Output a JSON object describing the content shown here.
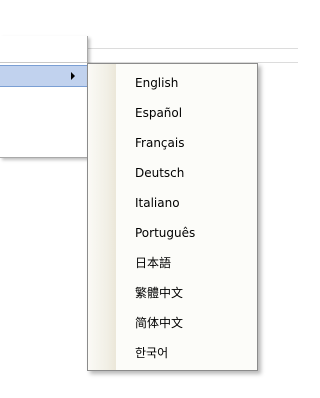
{
  "submenu": {
    "languages": [
      "English",
      "Español",
      "Français",
      "Deutsch",
      "Italiano",
      "Português",
      "日本語",
      "繁體中文",
      "简体中文",
      "한국어"
    ]
  },
  "colors": {
    "highlight": "#c1d2ee",
    "highlight_border": "#7b9fd4",
    "menu_background": "#fcfcf9",
    "menu_border": "#8b8b8b"
  },
  "icons": {
    "submenu_arrow": "chevron-right-icon"
  }
}
